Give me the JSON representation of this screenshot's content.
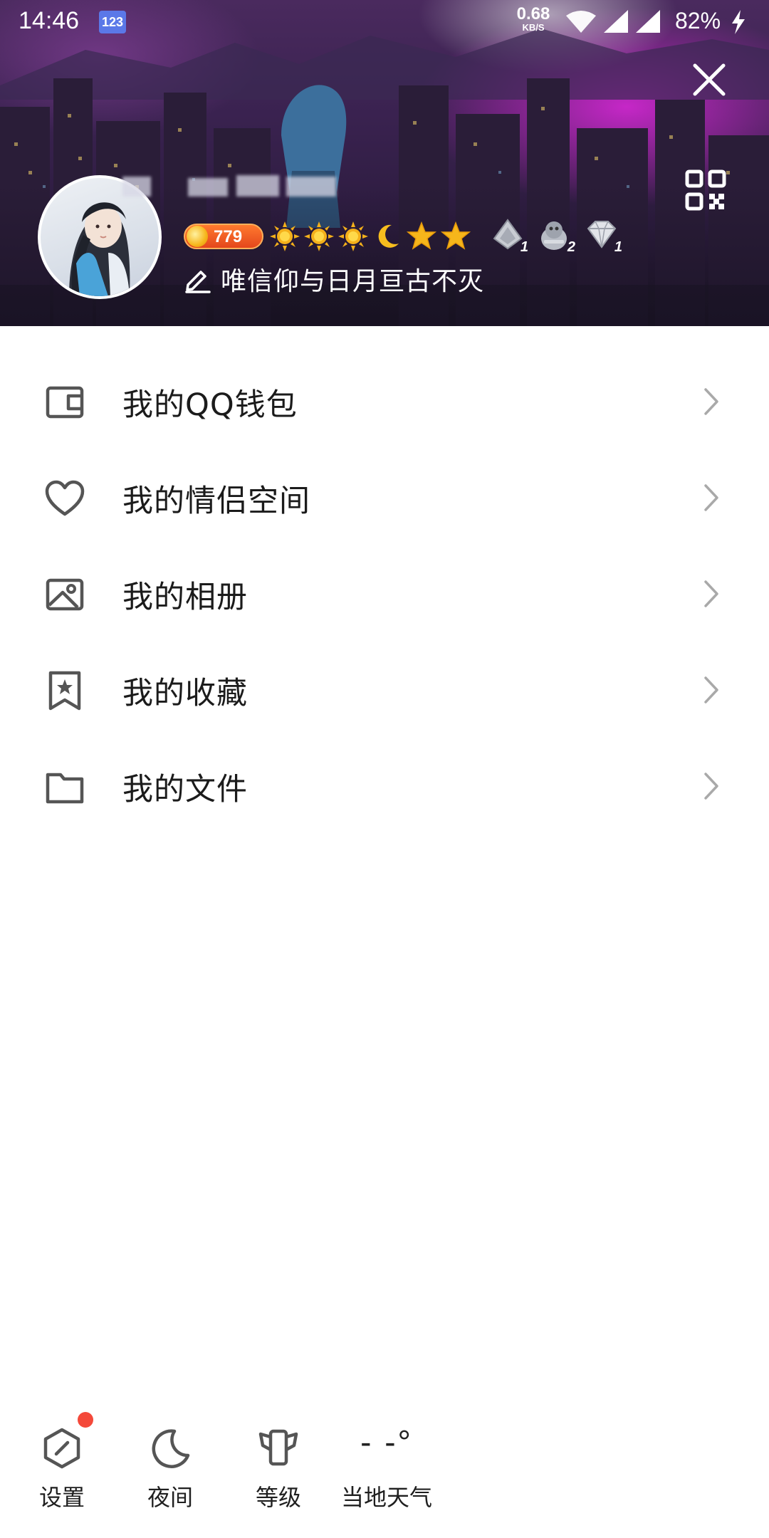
{
  "status_bar": {
    "time": "14:46",
    "badge": "123",
    "net_speed_value": "0.68",
    "net_speed_unit": "KB/S",
    "battery": "82%"
  },
  "header": {
    "coins": "779",
    "level_icons": [
      "sun-icon",
      "sun-icon",
      "sun-icon",
      "moon-icon",
      "star-icon",
      "star-icon"
    ],
    "medals": [
      {
        "icon": "silver-medal-icon",
        "count": "1"
      },
      {
        "icon": "penguin-medal-icon",
        "count": "2"
      },
      {
        "icon": "diamond-medal-icon",
        "count": "1"
      }
    ],
    "signature": "唯信仰与日月亘古不灭",
    "accent_color": "#d629d6"
  },
  "menu": {
    "items": [
      {
        "label": "我的QQ钱包",
        "icon": "wallet-icon"
      },
      {
        "label": "我的情侣空间",
        "icon": "heart-icon"
      },
      {
        "label": "我的相册",
        "icon": "album-icon"
      },
      {
        "label": "我的收藏",
        "icon": "bookmark-star-icon"
      },
      {
        "label": "我的文件",
        "icon": "folder-icon"
      }
    ]
  },
  "bottom_bar": {
    "items": [
      {
        "label": "设置",
        "icon": "settings-icon",
        "has_notification_dot": true
      },
      {
        "label": "夜间",
        "icon": "moon-icon"
      },
      {
        "label": "等级",
        "icon": "level-wings-icon"
      },
      {
        "label": "当地天气",
        "icon": "weather-temp",
        "value": "- -°"
      }
    ],
    "notification_color": "#f4493a"
  }
}
